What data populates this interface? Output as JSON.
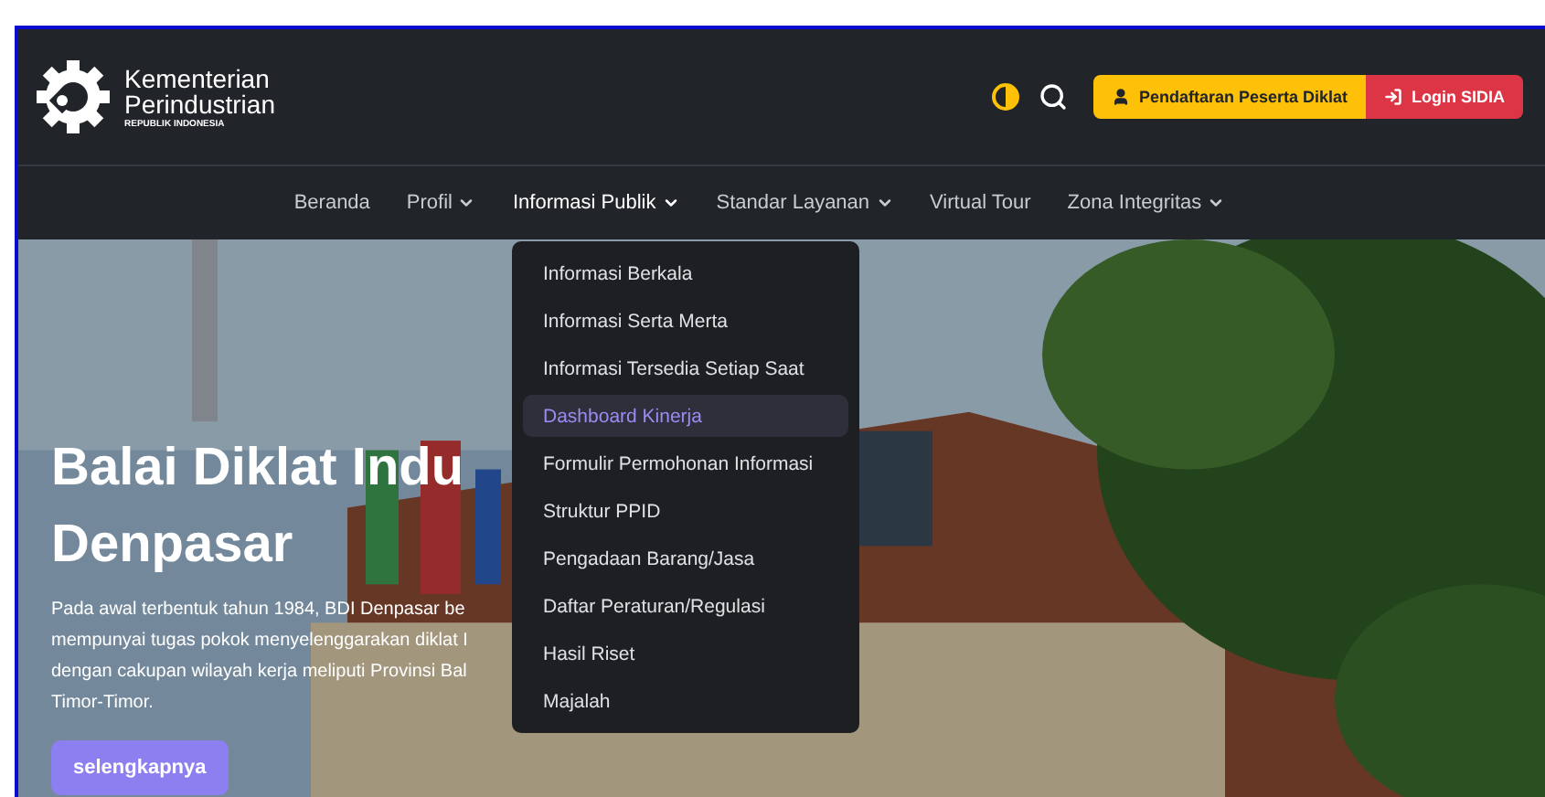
{
  "logo": {
    "name": "Kementerian",
    "name_2": "Perindustrian",
    "subtitle": "REPUBLIK INDONESIA"
  },
  "header_buttons": [
    {
      "label": "Pendaftaran Peserta Diklat",
      "kind": "register"
    },
    {
      "label": "Login SIDIA",
      "kind": "login"
    }
  ],
  "nav": [
    {
      "label": "Beranda",
      "dropdown": false,
      "expanded": false
    },
    {
      "label": "Profil",
      "dropdown": true,
      "expanded": false
    },
    {
      "label": "Informasi Publik",
      "dropdown": true,
      "expanded": true
    },
    {
      "label": "Standar Layanan",
      "dropdown": true,
      "expanded": false
    },
    {
      "label": "Virtual Tour",
      "dropdown": false,
      "expanded": false
    },
    {
      "label": "Zona Integritas",
      "dropdown": true,
      "expanded": false
    }
  ],
  "dropdown_items": [
    {
      "label": "Informasi Berkala",
      "selected": false
    },
    {
      "label": "Informasi Serta Merta",
      "selected": false
    },
    {
      "label": "Informasi Tersedia Setiap Saat",
      "selected": false
    },
    {
      "label": "Dashboard Kinerja",
      "selected": true
    },
    {
      "label": "Formulir Permohonan Informasi",
      "selected": false
    },
    {
      "label": "Struktur PPID",
      "selected": false
    },
    {
      "label": "Pengadaan Barang/Jasa",
      "selected": false
    },
    {
      "label": "Daftar Peraturan/Regulasi",
      "selected": false
    },
    {
      "label": "Hasil Riset",
      "selected": false
    },
    {
      "label": "Majalah",
      "selected": false
    }
  ],
  "hero": {
    "title_lines": [
      "Balai Diklat Indu",
      "Denpasar"
    ],
    "paragraph_lines": [
      "Pada awal terbentuk tahun 1984, BDI Denpasar be",
      "mempunyai tugas pokok menyelenggarakan diklat I",
      "dengan cakupan wilayah kerja meliputi Provinsi Bal",
      "Timor-Timor."
    ],
    "button": "selengkapnya"
  }
}
